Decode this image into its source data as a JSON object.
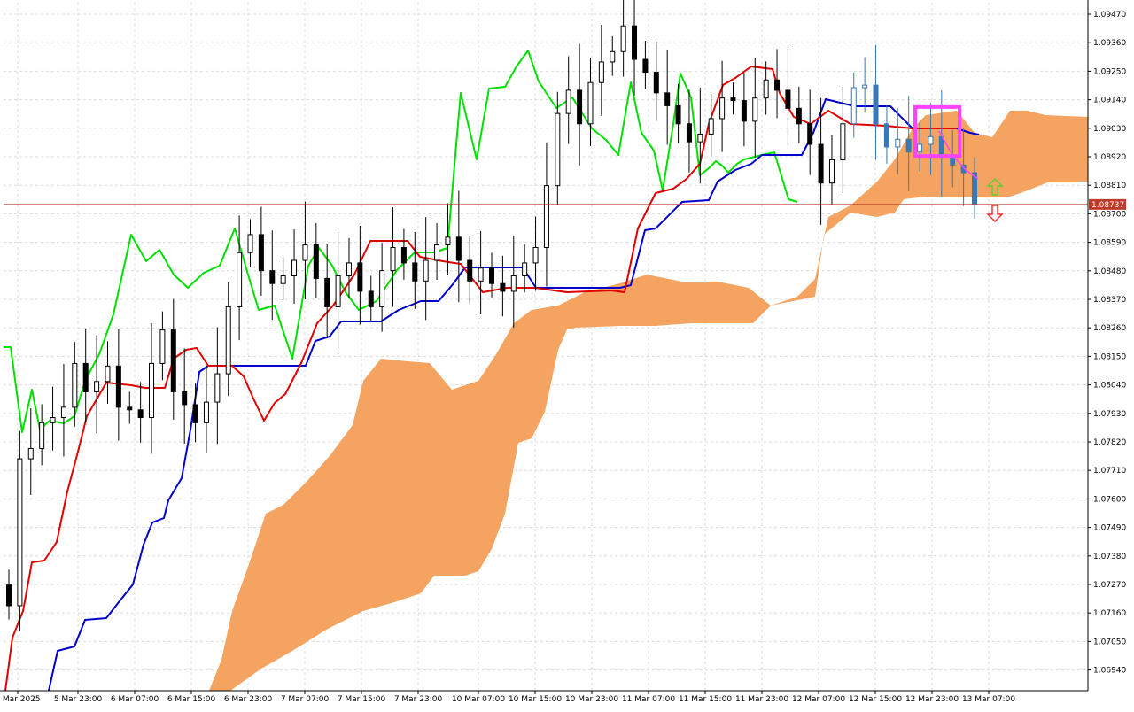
{
  "chart_data": {
    "type": "candlestick",
    "price_axis": {
      "min": 1.0685,
      "max": 1.0952,
      "ticks": [
        "1.09470",
        "1.09360",
        "1.09250",
        "1.09140",
        "1.09030",
        "1.08920",
        "1.08810",
        "1.08700",
        "1.08590",
        "1.08480",
        "1.08370",
        "1.08260",
        "1.08150",
        "1.08040",
        "1.07930",
        "1.07820",
        "1.07710",
        "1.07600",
        "1.07490",
        "1.07380",
        "1.07270",
        "1.07160",
        "1.07050",
        "1.06940"
      ]
    },
    "time_axis": {
      "labels": [
        "5 Mar 2025",
        "5 Mar 23:00",
        "6 Mar 07:00",
        "6 Mar 15:00",
        "6 Mar 23:00",
        "7 Mar 07:00",
        "7 Mar 15:00",
        "7 Mar 23:00",
        "10 Mar 07:00",
        "10 Mar 15:00",
        "10 Mar 23:00",
        "11 Mar 07:00",
        "11 Mar 15:00",
        "11 Mar 23:00",
        "12 Mar 07:00",
        "12 Mar 15:00",
        "12 Mar 23:00",
        "13 Mar 07:00"
      ]
    },
    "current_price": {
      "value": 1.08737,
      "label": "1.08737"
    },
    "candle_close_path": [
      1.0718,
      1.0775,
      1.0779,
      1.0789,
      1.0791,
      1.0795,
      1.0812,
      1.0801,
      1.0805,
      1.0811,
      1.0795,
      1.0794,
      1.0791,
      1.0812,
      1.0825,
      1.0801,
      1.0796,
      1.0789,
      1.0797,
      1.0808,
      1.0834,
      1.0855,
      1.0862,
      1.0848,
      1.0843,
      1.0846,
      1.0852,
      1.0858,
      1.0845,
      1.0834,
      1.0846,
      1.0851,
      1.084,
      1.0834,
      1.0848,
      1.0857,
      1.0851,
      1.0844,
      1.0852,
      1.0858,
      1.0861,
      1.0852,
      1.0844,
      1.0849,
      1.0843,
      1.084,
      1.0846,
      1.0851,
      1.0857,
      1.0881,
      1.0909,
      1.0918,
      1.0905,
      1.0921,
      1.0929,
      1.0933,
      1.0943,
      1.093,
      1.0925,
      1.0917,
      1.0912,
      1.0905,
      1.0898,
      1.0901,
      1.0907,
      1.0915,
      1.0914,
      1.0906,
      1.0915,
      1.0922,
      1.0918,
      1.0911,
      1.0905,
      1.0897,
      1.0882,
      1.0891,
      1.0905,
      1.0919,
      1.092,
      1.0905,
      1.0896,
      1.0899,
      1.0894,
      1.0897,
      1.09,
      1.0893,
      1.0889,
      1.0886,
      1.08737
    ],
    "series": [
      {
        "role": "tenkan-sen",
        "color": "#e00000"
      },
      {
        "role": "kijun-sen",
        "color": "#0000cc"
      },
      {
        "role": "chikou-span",
        "color": "#00e000"
      },
      {
        "role": "kumo",
        "color": "#f4a460"
      },
      {
        "role": "candles",
        "color": "#000000",
        "recent_color": "#3a78b5"
      }
    ],
    "annotations": [
      {
        "type": "rectangle",
        "color": "#ff44ff",
        "time_index_range": [
          1033,
          1083
        ],
        "price_range": [
          1.08925,
          1.09115
        ]
      },
      {
        "type": "arrow-up",
        "color": "#66cc33"
      },
      {
        "type": "arrow-down",
        "color": "#ee3333"
      }
    ],
    "grid": true
  }
}
